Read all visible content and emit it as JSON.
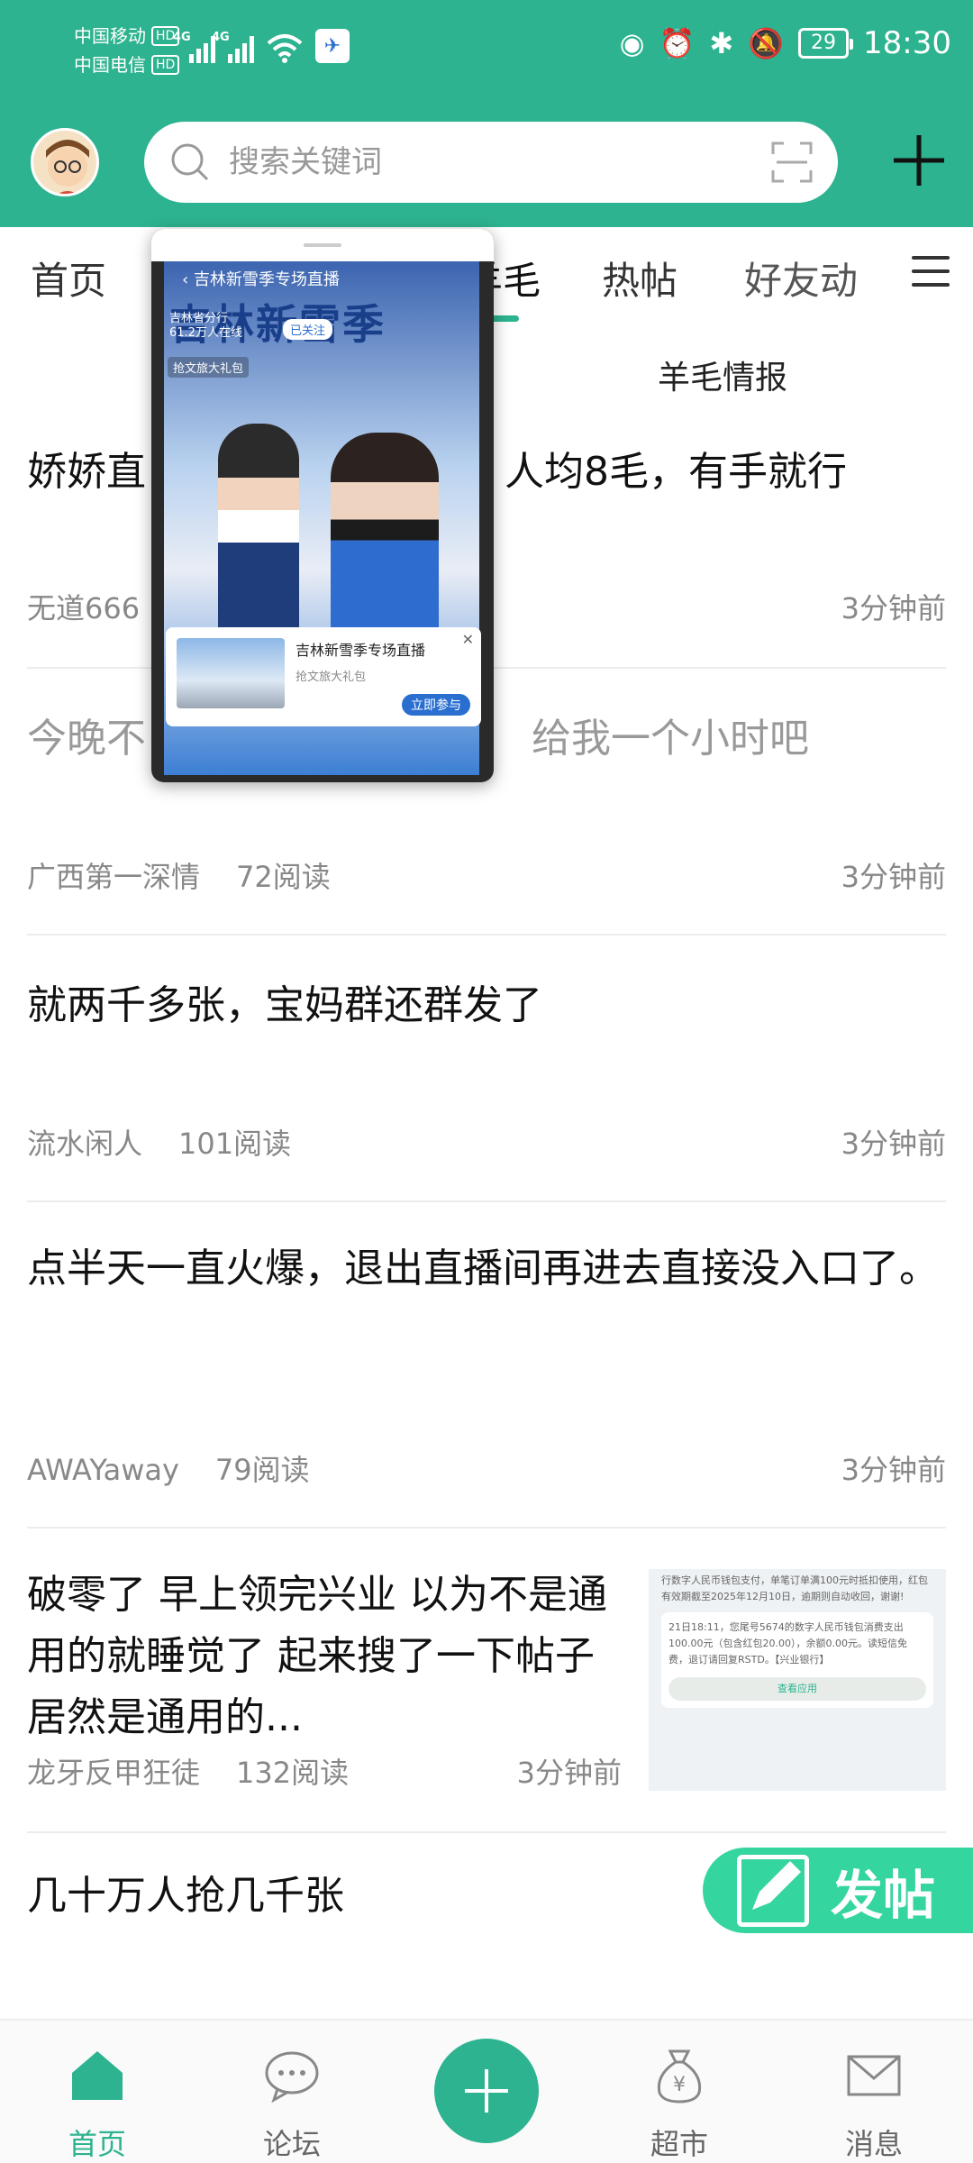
{
  "status": {
    "carrier1": "中国移动",
    "carrier2": "中国电信",
    "hd": "HD",
    "net": "4G",
    "battery": "29",
    "time": "18:30"
  },
  "header": {
    "search_placeholder": "搜索关键词"
  },
  "tabs": {
    "home": "首页",
    "wool": "羊毛",
    "hot": "热帖",
    "friends": "好友动"
  },
  "subtitle": "羊毛情报",
  "popup": {
    "title": "吉林新雪季",
    "header": "吉林新雪季专场直播",
    "channel": "吉林省分行",
    "followers": "61.2万人在线",
    "follow": "已关注",
    "tag": "抢文旅大礼包",
    "ad_title": "吉林新雪季专场直播",
    "ad_sub": "抢文旅大礼包",
    "ad_button": "立即参与"
  },
  "posts": [
    {
      "title": "娇娇直",
      "title_suffix": "人均8毛，有手就行",
      "author": "无道666",
      "reads": "",
      "time": "3分钟前"
    },
    {
      "title": "今晚不",
      "title_suffix": "给我一个小时吧",
      "author": "广西第一深情",
      "reads": "72阅读",
      "time": "3分钟前"
    },
    {
      "title": "就两千多张，宝妈群还群发了",
      "author": "流水闲人",
      "reads": "101阅读",
      "time": "3分钟前"
    },
    {
      "title": "点半天一直火爆，退出直播间再进去直接没入口了。",
      "author": "AWAYaway",
      "reads": "79阅读",
      "time": "3分钟前"
    },
    {
      "title": "破零了 早上领完兴业 以为不是通用的就睡觉了 起来搜了一下帖子 居然是通用的...",
      "author": "龙牙反甲狂徒",
      "reads": "132阅读",
      "time": "3分钟前"
    },
    {
      "title": "几十万人抢几千张"
    }
  ],
  "thumb": {
    "line1": "行数字人民币钱包支付，单笔订单满100元时抵扣使用，红包有效期截至2025年12月10日，逾期则自动收回，谢谢!",
    "line2": "21日18:11，您尾号5674的数字人民币钱包消费支出100.00元（包含红包20.00），余额0.00元。读短信免费，退订请回复RSTD。【兴业银行】",
    "btn": "查看应用"
  },
  "fab": "发帖",
  "bottom_nav": {
    "home": "首页",
    "forum": "论坛",
    "market": "超市",
    "messages": "消息"
  }
}
